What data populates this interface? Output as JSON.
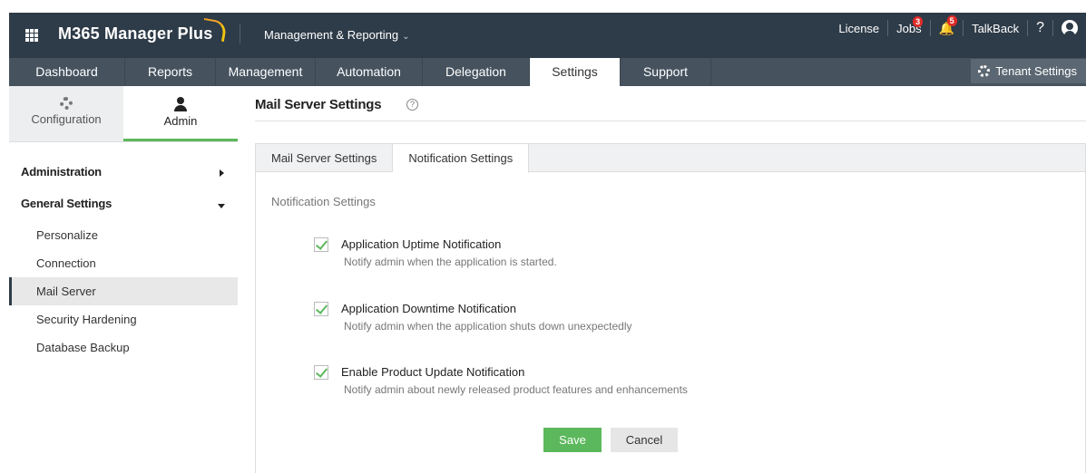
{
  "header": {
    "app_title": "M365 Manager Plus",
    "module_menu": "Management & Reporting",
    "license": "License",
    "jobs": "Jobs",
    "jobs_count": "3",
    "alerts_count": "5",
    "talkback": "TalkBack",
    "help": "?"
  },
  "nav": {
    "tabs": [
      "Dashboard",
      "Reports",
      "Management",
      "Automation",
      "Delegation",
      "Settings",
      "Support"
    ],
    "active": "Settings",
    "tenant_settings": "Tenant Settings"
  },
  "sidebar": {
    "tabs": {
      "configuration": "Configuration",
      "admin": "Admin"
    },
    "sections": {
      "administration": "Administration",
      "general_settings": "General Settings"
    },
    "items": [
      "Personalize",
      "Connection",
      "Mail Server",
      "Security Hardening",
      "Database Backup"
    ],
    "selected": "Mail Server"
  },
  "main": {
    "page_title": "Mail Server Settings",
    "help_icon": "?",
    "tabs": [
      "Mail Server Settings",
      "Notification Settings"
    ],
    "active_tab": "Notification Settings",
    "section_label": "Notification Settings",
    "options": [
      {
        "label": "Application Uptime Notification",
        "description": "Notify admin when the application is started.",
        "checked": true
      },
      {
        "label": "Application Downtime Notification",
        "description": "Notify admin when the application shuts down unexpectedly",
        "checked": true
      },
      {
        "label": "Enable Product Update Notification",
        "description": "Notify admin about newly released product features and enhancements",
        "checked": true
      }
    ],
    "save": "Save",
    "cancel": "Cancel"
  },
  "colors": {
    "topbar": "#2e3b48",
    "navbar": "#46535f",
    "accent_green": "#5cb85c",
    "badge_red": "#e02b27"
  }
}
